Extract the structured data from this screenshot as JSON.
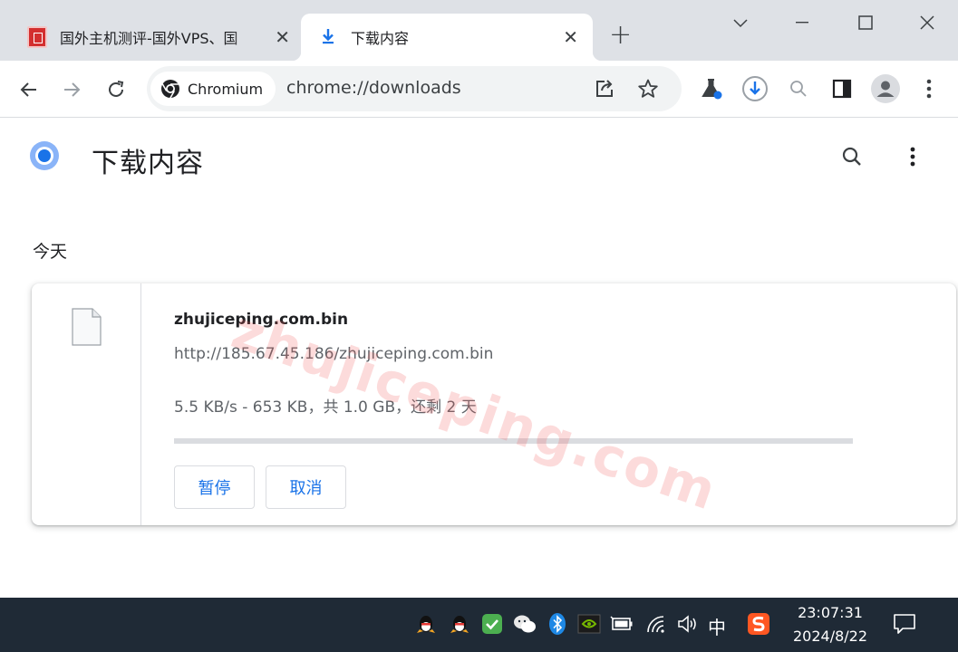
{
  "tabs": [
    {
      "title": "国外主机测评-国外VPS、国",
      "close": "✕"
    },
    {
      "title": "下载内容",
      "close": "✕"
    }
  ],
  "new_tab": "+",
  "omnibox": {
    "chip_label": "Chromium",
    "url": "chrome://downloads"
  },
  "page": {
    "title": "下载内容"
  },
  "downloads": {
    "date_group": "今天",
    "item": {
      "file_name": "zhujiceping.com.bin",
      "url": "http://185.67.45.186/zhujiceping.com.bin",
      "status": "5.5 KB/s - 653 KB，共 1.0 GB，还剩 2 天",
      "progress_percent": 0,
      "pause_label": "暂停",
      "cancel_label": "取消"
    }
  },
  "watermark": "zhujiceping.com",
  "taskbar": {
    "ime": "中",
    "time": "23:07:31",
    "date": "2024/8/22"
  },
  "colors": {
    "accent": "#1a73e8",
    "tabstrip": "#dee1e6",
    "taskbar": "#1f2a36"
  }
}
